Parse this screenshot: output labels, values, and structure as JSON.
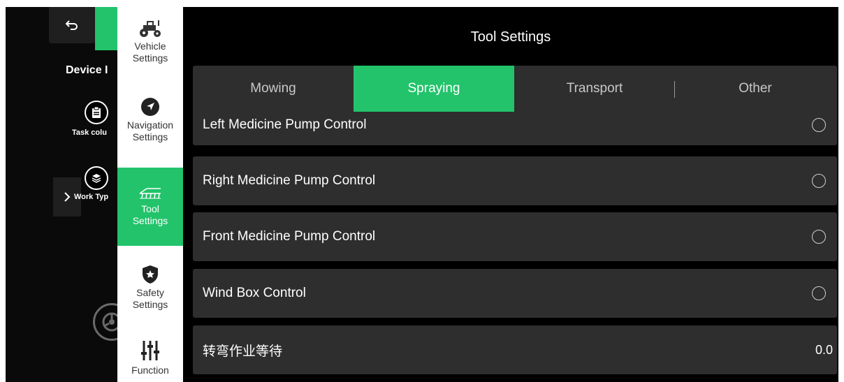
{
  "background_panel": {
    "device_title": "Device I",
    "task_column_label": "Task colu",
    "work_type_label": "Work Typ"
  },
  "nav": {
    "items": [
      {
        "label_line1": "Vehicle",
        "label_line2": "Settings",
        "icon": "tractor-icon",
        "active": false
      },
      {
        "label_line1": "Navigation",
        "label_line2": "Settings",
        "icon": "navigation-arrow-icon",
        "active": false
      },
      {
        "label_line1": "Tool",
        "label_line2": "Settings",
        "icon": "sprayer-icon",
        "active": true
      },
      {
        "label_line1": "Safety",
        "label_line2": "Settings",
        "icon": "shield-star-icon",
        "active": false
      },
      {
        "label_line1": "Function",
        "label_line2": "",
        "icon": "sliders-icon",
        "active": false
      }
    ]
  },
  "page": {
    "title": "Tool Settings"
  },
  "tabs": [
    {
      "label": "Mowing",
      "active": false
    },
    {
      "label": "Spraying",
      "active": true
    },
    {
      "label": "Transport",
      "active": false
    },
    {
      "label": "Other",
      "active": false
    }
  ],
  "settings": [
    {
      "label": "Left Medicine Pump Control",
      "control": "radio",
      "checked": false
    },
    {
      "label": "Right Medicine Pump Control",
      "control": "radio",
      "checked": false
    },
    {
      "label": "Front Medicine Pump Control",
      "control": "radio",
      "checked": false
    },
    {
      "label": "Wind Box Control",
      "control": "radio",
      "checked": false
    },
    {
      "label": "转弯作业等待",
      "control": "value",
      "value": "0.0"
    }
  ],
  "colors": {
    "accent": "#22c36b",
    "background": "#000000",
    "row": "#2e2e2e"
  }
}
